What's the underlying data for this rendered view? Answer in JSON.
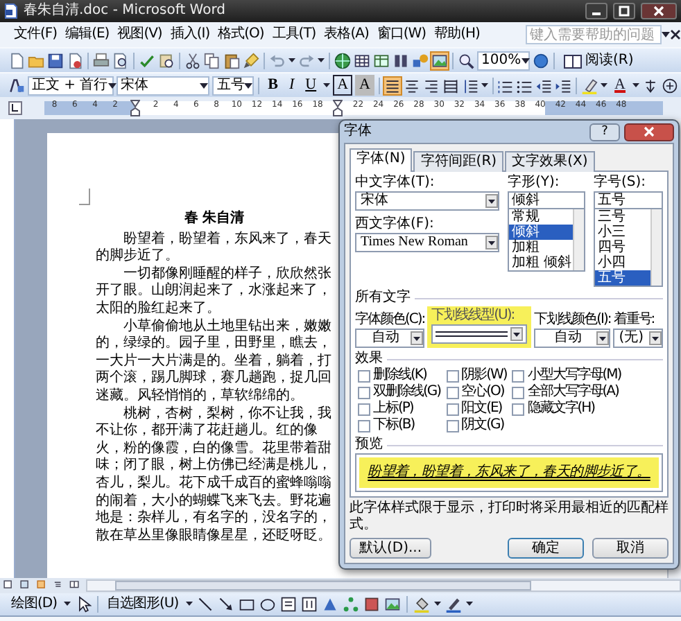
{
  "window": {
    "title": "春朱自清.doc - Microsoft Word"
  },
  "menu": [
    "文件(F)",
    "编辑(E)",
    "视图(V)",
    "插入(I)",
    "格式(O)",
    "工具(T)",
    "表格(A)",
    "窗口(W)",
    "帮助(H)"
  ],
  "help_search": {
    "placeholder": "键入需要帮助的问题"
  },
  "standard_toolbar": {
    "zoom": "100%",
    "read_button": "阅读(R)"
  },
  "formatting_toolbar": {
    "style": "正文 + 首行",
    "font": "宋体",
    "size": "五号",
    "letter_buttons": [
      {
        "kind": "bold",
        "text": "B"
      },
      {
        "kind": "italic",
        "text": "I"
      },
      {
        "kind": "underline",
        "text": "U"
      },
      {
        "kind": "border",
        "text": "A"
      },
      {
        "kind": "shading",
        "text": "A"
      }
    ],
    "alignment": [
      {
        "selected": true
      },
      {
        "selected": false
      },
      {
        "selected": false
      },
      {
        "selected": false
      }
    ],
    "font_color": "A"
  },
  "ruler": {
    "ticks": [
      {
        "kind": "number",
        "label": "8"
      },
      {
        "kind": "number",
        "label": "6"
      },
      {
        "kind": "number",
        "label": "4"
      },
      {
        "kind": "number",
        "label": "2"
      },
      {
        "kind": "indent_marker"
      },
      {
        "kind": "number",
        "label": "2"
      },
      {
        "kind": "number",
        "label": "4"
      },
      {
        "kind": "number",
        "label": "6"
      },
      {
        "kind": "number",
        "label": "8"
      },
      {
        "kind": "number",
        "label": "10"
      },
      {
        "kind": "number",
        "label": "12"
      },
      {
        "kind": "number",
        "label": "14"
      },
      {
        "kind": "number",
        "label": "16"
      },
      {
        "kind": "number",
        "label": "18"
      },
      {
        "kind": "indent_marker"
      },
      {
        "kind": "number",
        "label": "22"
      },
      {
        "kind": "number",
        "label": "24"
      },
      {
        "kind": "number",
        "label": "26"
      },
      {
        "kind": "number",
        "label": "28"
      },
      {
        "kind": "number",
        "label": "30"
      },
      {
        "kind": "number",
        "label": "32"
      },
      {
        "kind": "number",
        "label": "34"
      },
      {
        "kind": "number",
        "label": "36"
      },
      {
        "kind": "number",
        "label": "38"
      },
      {
        "kind": "number",
        "label": "40"
      },
      {
        "kind": "number",
        "label": "42"
      },
      {
        "kind": "number",
        "label": "44"
      },
      {
        "kind": "number",
        "label": "46"
      },
      {
        "kind": "number",
        "label": "48"
      }
    ]
  },
  "document": {
    "title": "春 朱自清",
    "paragraphs": [
      "盼望着，盼望着，东风来了，春天的脚步近了。",
      "一切都像刚睡醒的样子，欣欣然张开了眼。山朗润起来了，水涨起来了，太阳的脸红起来了。",
      "小草偷偷地从土地里钻出来，嫩嫩的，绿绿的。园子里，田野里，瞧去，一大片一大片满是的。坐着，躺着，打两个滚，踢几脚球，赛几趟跑，捉几回迷藏。风轻悄悄的，草软绵绵的。",
      "桃树，杏树，梨树，你不让我，我不让你，都开满了花赶趟儿。红的像火，粉的像霞，白的像雪。花里带着甜味；闭了眼，树上仿佛已经满是桃儿，杏儿，梨儿。花下成千成百的蜜蜂嗡嗡的闹着，大小的蝴蝶飞来飞去。野花遍地是：杂样儿，有名字的，没名字的，散在草丛里像眼睛像星星，还眨呀眨。"
    ]
  },
  "font_dialog": {
    "title": "字体",
    "help_button": "?",
    "tabs": [
      {
        "label": "字体(N)",
        "selected": true
      },
      {
        "label": "字符间距(R)",
        "selected": false
      },
      {
        "label": "文字效果(X)",
        "selected": false
      }
    ],
    "chinese_font": {
      "label": "中文字体(T):",
      "value": "宋体"
    },
    "western_font": {
      "label": "西文字体(F):",
      "value": "Times New Roman"
    },
    "font_style": {
      "label": "字形(Y):",
      "value": "倾斜",
      "options": [
        {
          "label": "常规",
          "selected": false
        },
        {
          "label": "倾斜",
          "selected": true
        },
        {
          "label": "加粗",
          "selected": false
        },
        {
          "label": "加粗 倾斜",
          "selected": false
        }
      ]
    },
    "font_size": {
      "label": "字号(S):",
      "value": "五号",
      "options": [
        {
          "label": "三号",
          "selected": false
        },
        {
          "label": "小三",
          "selected": false
        },
        {
          "label": "四号",
          "selected": false
        },
        {
          "label": "小四",
          "selected": false
        },
        {
          "label": "五号",
          "selected": true
        }
      ]
    },
    "all_text_heading": "所有文字",
    "font_color": {
      "label": "字体颜色(C):",
      "value": "自动"
    },
    "underline_style": {
      "label": "下划线线型(U):",
      "highlighted": true
    },
    "underline_color": {
      "label": "下划线颜色(I):",
      "value": "自动"
    },
    "emphasis_mark": {
      "label": "着重号:",
      "value": "(无)"
    },
    "effects_heading": "效果",
    "effects": [
      {
        "label": "删除线(K)",
        "checked": false
      },
      {
        "label": "双删除线(G)",
        "checked": false
      },
      {
        "label": "上标(P)",
        "checked": false
      },
      {
        "label": "下标(B)",
        "checked": false
      },
      {
        "label": "阴影(W)",
        "checked": false
      },
      {
        "label": "空心(O)",
        "checked": false
      },
      {
        "label": "阳文(E)",
        "checked": false
      },
      {
        "label": "阴文(G)",
        "checked": false
      },
      {
        "label": "小型大写字母(M)",
        "checked": false
      },
      {
        "label": "全部大写字母(A)",
        "checked": false
      },
      {
        "label": "隐藏文字(H)",
        "checked": false
      }
    ],
    "preview_heading": "预览",
    "preview": {
      "text": "盼望着，盼望着，东风来了，春天的脚步近了。",
      "highlighted": true
    },
    "note": "此字体样式限于显示，打印时将采用最相近的匹配样式。",
    "buttons": [
      {
        "kind": "default",
        "label": "默认(D)..."
      },
      {
        "kind": "ok",
        "label": "确定"
      },
      {
        "kind": "cancel",
        "label": "取消"
      }
    ]
  },
  "drawing_toolbar": {
    "draw_menu": "绘图(D)",
    "autoshapes": "自选图形(U)"
  }
}
